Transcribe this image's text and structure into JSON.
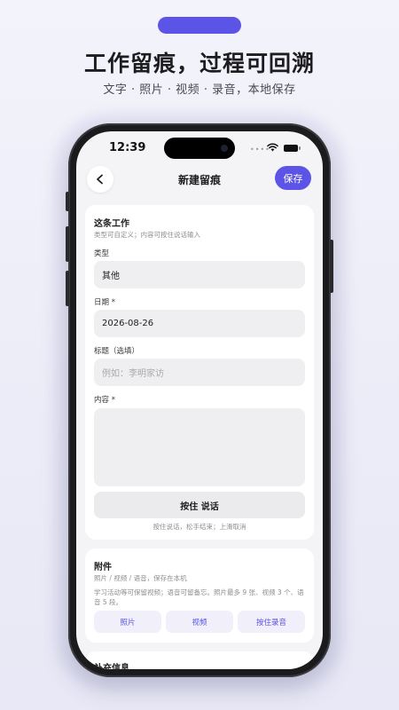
{
  "promo": {
    "headline": "工作留痕，过程可回溯",
    "subhead": "文字 · 照片 · 视频 · 录音，本地保存",
    "accent": "#5b54e6"
  },
  "status_bar": {
    "time": "12:39",
    "signal_dots": "••••"
  },
  "nav": {
    "title": "新建留痕",
    "save_label": "保存",
    "back_icon": "chevron-left-icon"
  },
  "work_card": {
    "title": "这条工作",
    "subtitle": "类型可自定义；内容可按住说话输入",
    "type_label": "类型",
    "type_value": "其他",
    "date_label": "日期 *",
    "date_value": "2026-08-26",
    "title_label": "标题（选填）",
    "title_placeholder": "例如：李明家访",
    "content_label": "内容 *",
    "content_value": "",
    "voice_button": "按住 说话",
    "voice_hint": "按住说话，松手结束；上滑取消"
  },
  "attachments_card": {
    "title": "附件",
    "subtitle": "照片 / 视频 / 语音，保存在本机",
    "note": "学习活动等可保留视频；语音可留备忘。照片最多 9 张、视频 3 个、语音 5 段。",
    "buttons": [
      "照片",
      "视频",
      "按住录音"
    ]
  },
  "third_card": {
    "title": "补充信息"
  }
}
